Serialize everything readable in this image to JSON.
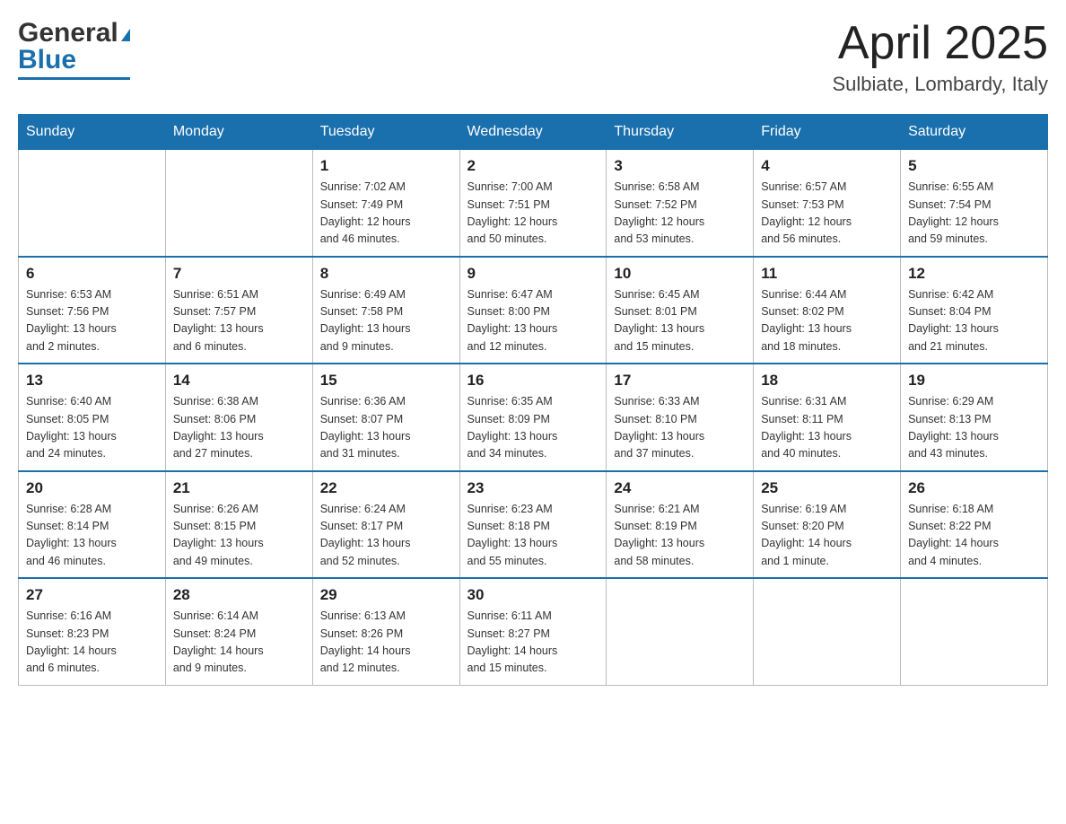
{
  "header": {
    "logo_general": "General",
    "logo_blue": "Blue",
    "month_title": "April 2025",
    "location": "Sulbiate, Lombardy, Italy"
  },
  "weekdays": [
    "Sunday",
    "Monday",
    "Tuesday",
    "Wednesday",
    "Thursday",
    "Friday",
    "Saturday"
  ],
  "weeks": [
    [
      {
        "day": "",
        "info": ""
      },
      {
        "day": "",
        "info": ""
      },
      {
        "day": "1",
        "info": "Sunrise: 7:02 AM\nSunset: 7:49 PM\nDaylight: 12 hours\nand 46 minutes."
      },
      {
        "day": "2",
        "info": "Sunrise: 7:00 AM\nSunset: 7:51 PM\nDaylight: 12 hours\nand 50 minutes."
      },
      {
        "day": "3",
        "info": "Sunrise: 6:58 AM\nSunset: 7:52 PM\nDaylight: 12 hours\nand 53 minutes."
      },
      {
        "day": "4",
        "info": "Sunrise: 6:57 AM\nSunset: 7:53 PM\nDaylight: 12 hours\nand 56 minutes."
      },
      {
        "day": "5",
        "info": "Sunrise: 6:55 AM\nSunset: 7:54 PM\nDaylight: 12 hours\nand 59 minutes."
      }
    ],
    [
      {
        "day": "6",
        "info": "Sunrise: 6:53 AM\nSunset: 7:56 PM\nDaylight: 13 hours\nand 2 minutes."
      },
      {
        "day": "7",
        "info": "Sunrise: 6:51 AM\nSunset: 7:57 PM\nDaylight: 13 hours\nand 6 minutes."
      },
      {
        "day": "8",
        "info": "Sunrise: 6:49 AM\nSunset: 7:58 PM\nDaylight: 13 hours\nand 9 minutes."
      },
      {
        "day": "9",
        "info": "Sunrise: 6:47 AM\nSunset: 8:00 PM\nDaylight: 13 hours\nand 12 minutes."
      },
      {
        "day": "10",
        "info": "Sunrise: 6:45 AM\nSunset: 8:01 PM\nDaylight: 13 hours\nand 15 minutes."
      },
      {
        "day": "11",
        "info": "Sunrise: 6:44 AM\nSunset: 8:02 PM\nDaylight: 13 hours\nand 18 minutes."
      },
      {
        "day": "12",
        "info": "Sunrise: 6:42 AM\nSunset: 8:04 PM\nDaylight: 13 hours\nand 21 minutes."
      }
    ],
    [
      {
        "day": "13",
        "info": "Sunrise: 6:40 AM\nSunset: 8:05 PM\nDaylight: 13 hours\nand 24 minutes."
      },
      {
        "day": "14",
        "info": "Sunrise: 6:38 AM\nSunset: 8:06 PM\nDaylight: 13 hours\nand 27 minutes."
      },
      {
        "day": "15",
        "info": "Sunrise: 6:36 AM\nSunset: 8:07 PM\nDaylight: 13 hours\nand 31 minutes."
      },
      {
        "day": "16",
        "info": "Sunrise: 6:35 AM\nSunset: 8:09 PM\nDaylight: 13 hours\nand 34 minutes."
      },
      {
        "day": "17",
        "info": "Sunrise: 6:33 AM\nSunset: 8:10 PM\nDaylight: 13 hours\nand 37 minutes."
      },
      {
        "day": "18",
        "info": "Sunrise: 6:31 AM\nSunset: 8:11 PM\nDaylight: 13 hours\nand 40 minutes."
      },
      {
        "day": "19",
        "info": "Sunrise: 6:29 AM\nSunset: 8:13 PM\nDaylight: 13 hours\nand 43 minutes."
      }
    ],
    [
      {
        "day": "20",
        "info": "Sunrise: 6:28 AM\nSunset: 8:14 PM\nDaylight: 13 hours\nand 46 minutes."
      },
      {
        "day": "21",
        "info": "Sunrise: 6:26 AM\nSunset: 8:15 PM\nDaylight: 13 hours\nand 49 minutes."
      },
      {
        "day": "22",
        "info": "Sunrise: 6:24 AM\nSunset: 8:17 PM\nDaylight: 13 hours\nand 52 minutes."
      },
      {
        "day": "23",
        "info": "Sunrise: 6:23 AM\nSunset: 8:18 PM\nDaylight: 13 hours\nand 55 minutes."
      },
      {
        "day": "24",
        "info": "Sunrise: 6:21 AM\nSunset: 8:19 PM\nDaylight: 13 hours\nand 58 minutes."
      },
      {
        "day": "25",
        "info": "Sunrise: 6:19 AM\nSunset: 8:20 PM\nDaylight: 14 hours\nand 1 minute."
      },
      {
        "day": "26",
        "info": "Sunrise: 6:18 AM\nSunset: 8:22 PM\nDaylight: 14 hours\nand 4 minutes."
      }
    ],
    [
      {
        "day": "27",
        "info": "Sunrise: 6:16 AM\nSunset: 8:23 PM\nDaylight: 14 hours\nand 6 minutes."
      },
      {
        "day": "28",
        "info": "Sunrise: 6:14 AM\nSunset: 8:24 PM\nDaylight: 14 hours\nand 9 minutes."
      },
      {
        "day": "29",
        "info": "Sunrise: 6:13 AM\nSunset: 8:26 PM\nDaylight: 14 hours\nand 12 minutes."
      },
      {
        "day": "30",
        "info": "Sunrise: 6:11 AM\nSunset: 8:27 PM\nDaylight: 14 hours\nand 15 minutes."
      },
      {
        "day": "",
        "info": ""
      },
      {
        "day": "",
        "info": ""
      },
      {
        "day": "",
        "info": ""
      }
    ]
  ]
}
